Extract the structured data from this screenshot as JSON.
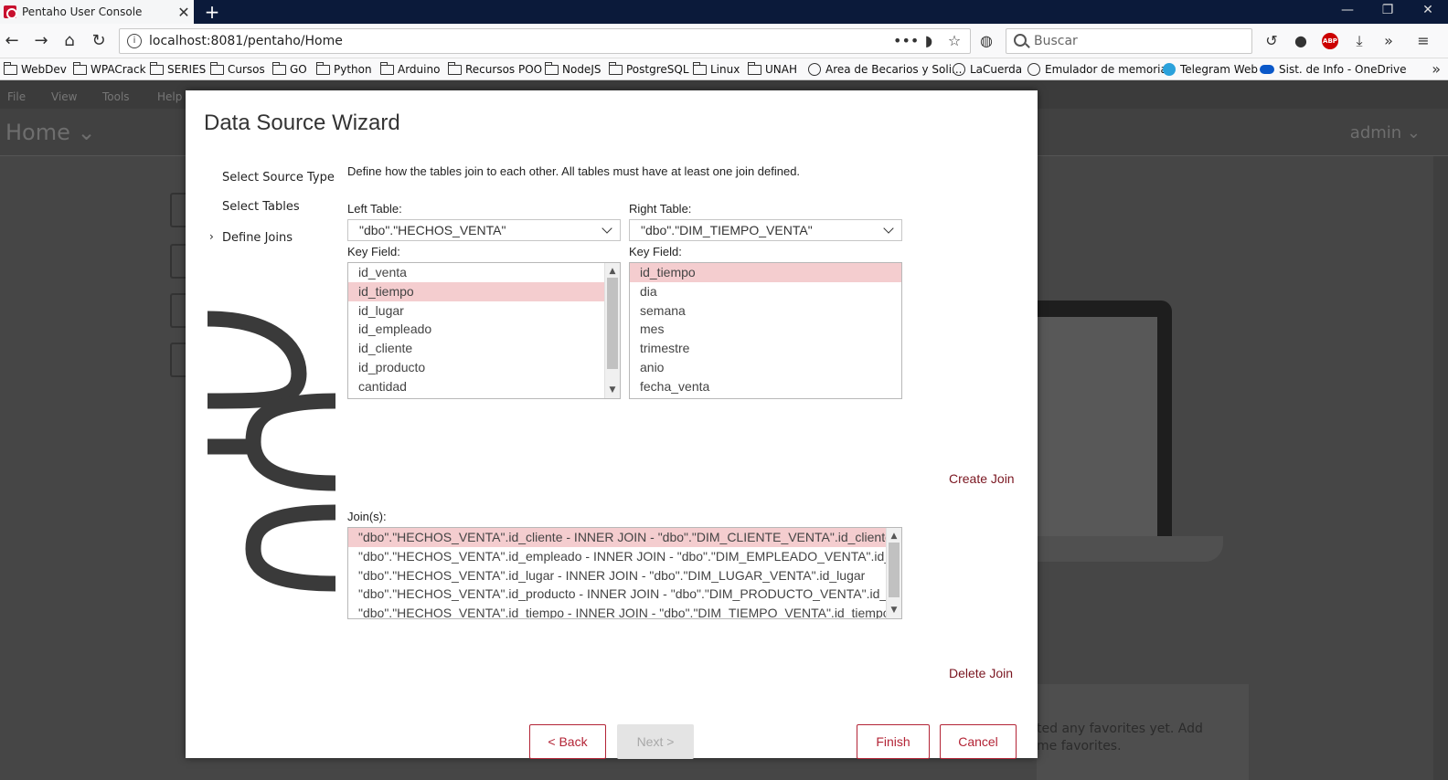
{
  "browser": {
    "tab_title": "Pentaho User Console",
    "tab_close": "✕",
    "new_tab": "+",
    "url": "localhost:8081/pentaho/Home",
    "url_more": "•••",
    "search_placeholder": "Buscar",
    "icons": {
      "back": "←",
      "forward": "→",
      "home": "⌂",
      "reload": "↻",
      "bookmark_star": "☆",
      "history": "↺",
      "download": "⤓",
      "overflow": "»",
      "menu": "≡",
      "abp": "ABP",
      "minimize": "—",
      "restore": "❐",
      "close": "✕"
    },
    "bookmarks": [
      {
        "label": "WebDev",
        "icon": "folder"
      },
      {
        "label": "WPACrack",
        "icon": "folder"
      },
      {
        "label": "SERIES",
        "icon": "folder"
      },
      {
        "label": "Cursos",
        "icon": "folder"
      },
      {
        "label": "GO",
        "icon": "folder"
      },
      {
        "label": "Python",
        "icon": "folder"
      },
      {
        "label": "Arduino",
        "icon": "folder"
      },
      {
        "label": "Recursos POO",
        "icon": "folder"
      },
      {
        "label": "NodeJS",
        "icon": "folder"
      },
      {
        "label": "PostgreSQL",
        "icon": "folder"
      },
      {
        "label": "Linux",
        "icon": "folder"
      },
      {
        "label": "UNAH",
        "icon": "folder"
      },
      {
        "label": "Area de Becarios y Soli...",
        "icon": "globe"
      },
      {
        "label": "LaCuerda",
        "icon": "globe"
      },
      {
        "label": "Emulador de memoria",
        "icon": "globe"
      },
      {
        "label": "Telegram Web",
        "icon": "telegram"
      },
      {
        "label": "Sist. de Info - OneDrive",
        "icon": "onedrive"
      }
    ],
    "bookmarks_more": "»"
  },
  "app": {
    "menu": [
      "File",
      "View",
      "Tools",
      "Help"
    ],
    "home_title": "Home ⌄",
    "user": "admin ⌄",
    "favorites_line1": "ted any favorites yet. Add",
    "favorites_line2": "me favorites."
  },
  "wizard": {
    "title": "Data Source Wizard",
    "steps": [
      "Select Source Type",
      "Select Tables",
      "Define Joins"
    ],
    "active_step_marker": "›",
    "description": "Define how the tables join to each other. All tables must have at least one join defined.",
    "left_table_label": "Left Table:",
    "left_table_value": "\"dbo\".\"HECHOS_VENTA\"",
    "right_table_label": "Right Table:",
    "right_table_value": "\"dbo\".\"DIM_TIEMPO_VENTA\"",
    "left_key_label": "Key Field:",
    "right_key_label": "Key Field:",
    "left_fields": [
      "id_venta",
      "id_tiempo",
      "id_lugar",
      "id_empleado",
      "id_cliente",
      "id_producto",
      "cantidad"
    ],
    "left_selected_index": 1,
    "right_fields": [
      "id_tiempo",
      "dia",
      "semana",
      "mes",
      "trimestre",
      "anio",
      "fecha_venta"
    ],
    "right_selected_index": 0,
    "create_join": "Create Join",
    "joins_label": "Join(s):",
    "joins": [
      "\"dbo\".\"HECHOS_VENTA\".id_cliente - INNER JOIN - \"dbo\".\"DIM_CLIENTE_VENTA\".id_cliente",
      "\"dbo\".\"HECHOS_VENTA\".id_empleado - INNER JOIN - \"dbo\".\"DIM_EMPLEADO_VENTA\".id_empleado",
      "\"dbo\".\"HECHOS_VENTA\".id_lugar - INNER JOIN - \"dbo\".\"DIM_LUGAR_VENTA\".id_lugar",
      "\"dbo\".\"HECHOS_VENTA\".id_producto - INNER JOIN - \"dbo\".\"DIM_PRODUCTO_VENTA\".id_producto",
      "\"dbo\".\"HECHOS_VENTA\".id_tiempo - INNER JOIN - \"dbo\".\"DIM_TIEMPO_VENTA\".id_tiempo"
    ],
    "joins_selected_index": 0,
    "delete_join": "Delete Join",
    "buttons": {
      "back": "< Back",
      "next": "Next >",
      "finish": "Finish",
      "cancel": "Cancel"
    },
    "colors": {
      "accent": "#b32436",
      "selection": "#f4cdcf",
      "link": "#7a1620"
    }
  }
}
